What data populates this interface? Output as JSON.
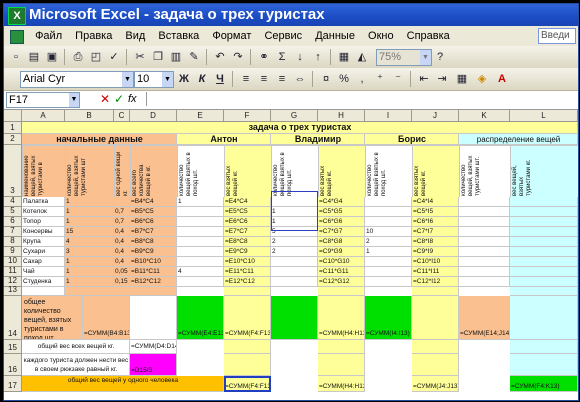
{
  "window": {
    "title": "Microsoft Excel - задача о трех туристах"
  },
  "menu": {
    "items": [
      "Файл",
      "Правка",
      "Вид",
      "Вставка",
      "Формат",
      "Сервис",
      "Данные",
      "Окно",
      "Справка"
    ],
    "ask_placeholder": "Введи"
  },
  "toolbar": {
    "font_name": "Arial Cyr",
    "font_size": "10",
    "zoom": "75%",
    "bold": "Ж",
    "italic": "К",
    "underline": "Ч"
  },
  "formula_bar": {
    "name_box": "F17",
    "fx": "fx"
  },
  "columns": [
    "A",
    "B",
    "C",
    "D",
    "E",
    "F",
    "G",
    "H",
    "I",
    "J",
    "K",
    "L"
  ],
  "rows": [
    "1",
    "2",
    "3",
    "4",
    "5",
    "6",
    "7",
    "8",
    "9",
    "10",
    "11",
    "12",
    "13",
    "14",
    "15",
    "16",
    "17"
  ],
  "sheet": {
    "title": "задача о трех туристах",
    "group_initial": "начальные данные",
    "group_anton": "Антон",
    "group_vladimir": "Владимир",
    "group_boris": "Борис",
    "group_distribution": "распределение вещей",
    "h_name": "наименование вещей, взятых туристами в",
    "h_qty": "количество вещей, взятых туристами шт",
    "h_weight1": "вес одной вещи кг.",
    "h_weight_total": "вес всего количества вещей в кг.",
    "h_a_qty": "количество вещей взятых в поход шт.",
    "h_a_weight": "вес взятых вещей кг.",
    "h_v_qty": "количество вещей взятых в поход шт.",
    "h_v_weight": "вес взятых вещей кг.",
    "h_b_qty": "количество вещей взятых в поход шт.",
    "h_b_weight": "вес взятых вещей кг.",
    "h_k_qty": "количество вещей, взятых туристами шт.",
    "h_l_weight": "вес вещей, взятых туристами кг.",
    "items": [
      {
        "name": "Палатка",
        "qty": "1",
        "w": "",
        "d": "=B4*C4",
        "e": "1",
        "f": "=E4*C4",
        "g": "",
        "h": "=C4*G4",
        "i": "",
        "j": "=C4*I4"
      },
      {
        "name": "Котелок",
        "qty": "1",
        "w": "0,7",
        "d": "=B5*C5",
        "e": "",
        "f": "=E5*C5",
        "g": "1",
        "h": "=C5*G5",
        "i": "",
        "j": "=C5*I5"
      },
      {
        "name": "Топор",
        "qty": "1",
        "w": "0,7",
        "d": "=B6*C6",
        "e": "",
        "f": "=E6*C6",
        "g": "1",
        "h": "=C6*G6",
        "i": "",
        "j": "=C6*I6"
      },
      {
        "name": "Консервы",
        "qty": "15",
        "w": "0,4",
        "d": "=B7*C7",
        "e": "",
        "f": "=E7*C7",
        "g": "5",
        "h": "=C7*G7",
        "i": "10",
        "j": "=C7*I7"
      },
      {
        "name": "Крупа",
        "qty": "4",
        "w": "0,4",
        "d": "=B8*C8",
        "e": "",
        "f": "=E8*C8",
        "g": "2",
        "h": "=C8*G8",
        "i": "2",
        "j": "=C8*I8"
      },
      {
        "name": "Сухари",
        "qty": "3",
        "w": "0,4",
        "d": "=B9*C9",
        "e": "",
        "f": "=E9*C9",
        "g": "2",
        "h": "=C9*G9",
        "i": "1",
        "j": "=C9*I9"
      },
      {
        "name": "Сахар",
        "qty": "1",
        "w": "0,4",
        "d": "=B10*C10",
        "e": "",
        "f": "=E10*C10",
        "g": "",
        "h": "=C10*G10",
        "i": "",
        "j": "=C10*I10"
      },
      {
        "name": "Чай",
        "qty": "1",
        "w": "0,05",
        "d": "=B11*C11",
        "e": "4",
        "f": "=E11*C11",
        "g": "",
        "h": "=C11*G11",
        "i": "",
        "j": "=C11*I11"
      },
      {
        "name": "Студенка",
        "qty": "1",
        "w": "0,15",
        "d": "=B12*C12",
        "e": "",
        "f": "=E12*C12",
        "g": "",
        "h": "=C12*G12",
        "i": "",
        "j": "=C12*I12"
      }
    ],
    "r14_label": "общее количество вещей, взятых туристами в поход шт.",
    "r14_b": "=СУММ(B4:B13)",
    "r14_e": "=СУММ(E4:E13)",
    "r14_f": "=СУММ(F4:F13)",
    "r14_h": "=СУММ(H4:H13)",
    "r14_i": "=СУММ(I4:I13)",
    "r14_k": "=СУММ(E14;J14)",
    "r15_label": "общий вес всех вещей   кг.",
    "r15_d": "=СУММ(D4:D14)",
    "r16_label": "каждого туриста должен нести вес в своем рюкзаке равный   кг.",
    "r16_d": "=D15/3",
    "r17_label": "общий вес вещей у одного человека",
    "r17_f": "=СУММ(F4:F13)",
    "r17_h": "=СУММ(H4:H13)",
    "r17_j": "=СУММ(J4:J13)",
    "r17_l": "=СУММ(F4:K13)"
  },
  "colors": {
    "title_bar": "#1b4cc4",
    "yellow": "#ffff99",
    "peach": "#fac090",
    "green": "#00e000",
    "magenta": "#ff00ff",
    "orange": "#ffc000",
    "aqua": "#ccffff"
  }
}
